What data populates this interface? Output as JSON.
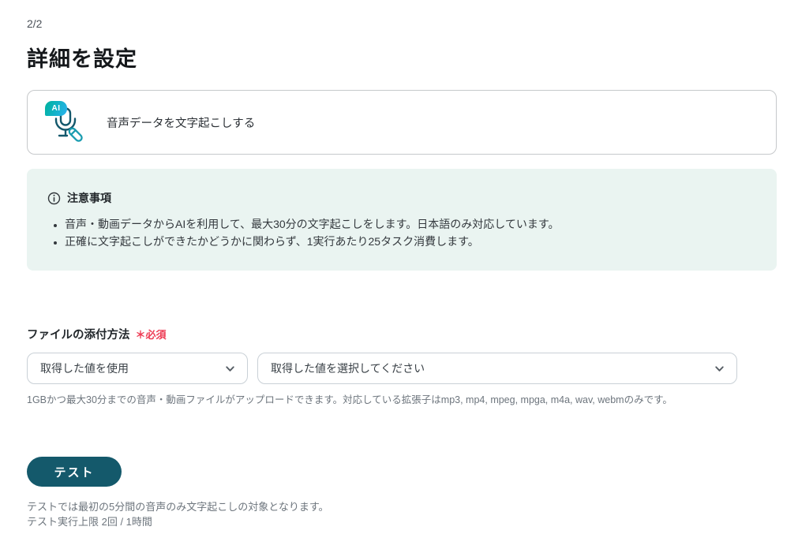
{
  "colors": {
    "accent_teal": "#14596b",
    "badge_gradient_start": "#00b2a4",
    "badge_gradient_end": "#25b2e8",
    "notice_background": "#eaf4f1",
    "required_red": "#ed3a53"
  },
  "header": {
    "step_indicator": "2/2",
    "title": "詳細を設定"
  },
  "action_card": {
    "badge_label": "AI",
    "icon": "microphone-pencil-icon",
    "label": "音声データを文字起こしする"
  },
  "notice": {
    "icon": "info-icon",
    "title": "注意事項",
    "items": [
      "音声・動画データからAIを利用して、最大30分の文字起こしをします。日本語のみ対応しています。",
      "正確に文字起こしができたかどうかに関わらず、1実行あたり25タスク消費します。"
    ]
  },
  "file_attachment": {
    "label": "ファイルの添付方法",
    "required_badge": "＊必須",
    "method_select": {
      "value": "取得した値を使用",
      "icon": "chevron-down-icon"
    },
    "file_select": {
      "value": "取得した値を選択してください",
      "icon": "chevron-down-icon"
    },
    "helper_text": "1GBかつ最大30分までの音声・動画ファイルがアップロードできます。対応している拡張子はmp3, mp4, mpeg, mpga, m4a, wav, webmのみです。"
  },
  "test_section": {
    "button_label": "テスト",
    "notes": [
      "テストでは最初の5分間の音声のみ文字起こしの対象となります。",
      "テスト実行上限 2回 / 1時間"
    ]
  }
}
